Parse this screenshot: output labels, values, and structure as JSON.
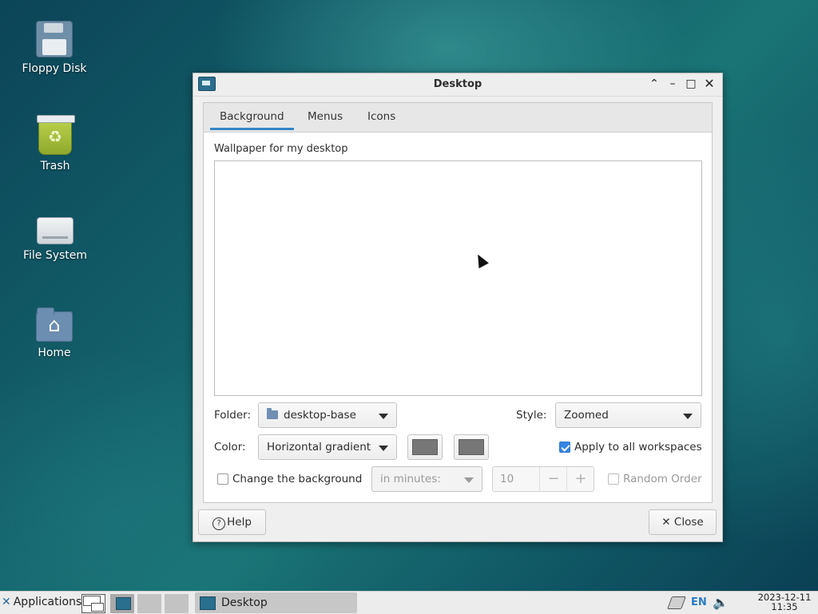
{
  "desktop_icons": [
    {
      "label": "Floppy Disk",
      "icon": "floppy-disk-icon"
    },
    {
      "label": "Trash",
      "icon": "trash-icon"
    },
    {
      "label": "File System",
      "icon": "drive-icon"
    },
    {
      "label": "Home",
      "icon": "home-folder-icon"
    }
  ],
  "window": {
    "title": "Desktop",
    "tabs": [
      "Background",
      "Menus",
      "Icons"
    ],
    "active_tab": "Background",
    "wallpaper_label": "Wallpaper for my desktop",
    "folder_label": "Folder:",
    "folder_value": "desktop-base",
    "style_label": "Style:",
    "style_value": "Zoomed",
    "color_label": "Color:",
    "color_value": "Horizontal gradient",
    "color1": "#777777",
    "color2": "#777777",
    "apply_all_label": "Apply to all workspaces",
    "apply_all_checked": true,
    "change_bg_label": "Change the background",
    "change_bg_checked": false,
    "interval_value": "in minutes:",
    "interval_amount": "10",
    "random_order_label": "Random Order",
    "random_order_checked": false,
    "help_label": "Help",
    "close_label": "Close"
  },
  "taskbar": {
    "applications_label": "Applications",
    "task_label": "Desktop",
    "language": "EN",
    "date": "2023-12-11",
    "time": "11:35"
  },
  "colors": {
    "accent": "#3584e4",
    "tab_underline": "#3584c7"
  }
}
